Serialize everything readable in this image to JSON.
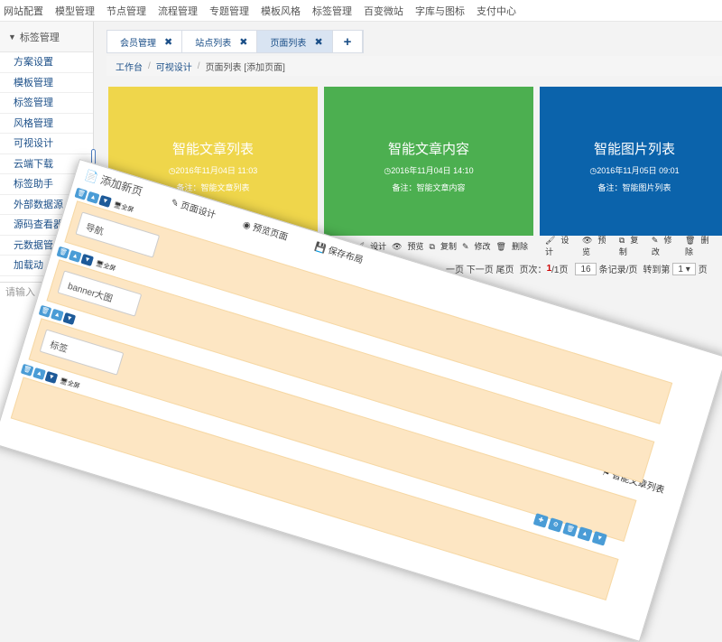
{
  "topnav": [
    "网站配置",
    "模型管理",
    "节点管理",
    "流程管理",
    "专题管理",
    "模板风格",
    "标签管理",
    "百变微站",
    "字库与图标",
    "支付中心"
  ],
  "sidebar": {
    "header": "标签管理",
    "items": [
      "方案设置",
      "模板管理",
      "标签管理",
      "风格管理",
      "可视设计",
      "云端下载",
      "标签助手",
      "外部数据源",
      "源码查看器",
      "元数据管",
      "加载动"
    ],
    "input_placeholder": "请输入"
  },
  "tabs": [
    {
      "label": "会员管理",
      "close": "✖"
    },
    {
      "label": "站点列表",
      "close": "✖"
    },
    {
      "label": "页面列表",
      "close": "✖"
    }
  ],
  "tab_add": "+",
  "breadcrumb": {
    "home": "工作台",
    "sep": "/",
    "level2": "可视设计",
    "current": "页面列表 [添加页面]"
  },
  "cards": [
    {
      "title": "智能文章列表",
      "date": "◷2016年11月04日 11:03",
      "note": "备注：智能文章列表",
      "color": "#efd64b"
    },
    {
      "title": "智能文章内容",
      "date": "◷2016年11月04日 14:10",
      "note": "备注：智能文章内容",
      "color": "#4caf50"
    },
    {
      "title": "智能图片列表",
      "date": "◷2016年11月05日 09:01",
      "note": "备注：智能图片列表",
      "color": "#0b63ab"
    }
  ],
  "card_actions": {
    "design": "设计",
    "preview": "预览",
    "copy": "复制",
    "edit": "修改",
    "delete": "删除"
  },
  "pager": {
    "prev": "一页 下一页 尾页",
    "pages_label": "页次：",
    "current": "1",
    "total": "/1页",
    "per_page": "16",
    "per_label": "条记录/页",
    "goto_label": "转到第",
    "goto_value": "1 ▾",
    "goto_suffix": "页"
  },
  "overlay": {
    "title": "添加新页",
    "toolbar": [
      "页面设计",
      "预览页面",
      "保存布局"
    ],
    "right_title": "智能文章列表",
    "full_label": "全屏",
    "rows": [
      {
        "field": "导航"
      },
      {
        "field": "banner大图"
      },
      {
        "field": "标签"
      },
      {
        "field": ""
      }
    ]
  }
}
